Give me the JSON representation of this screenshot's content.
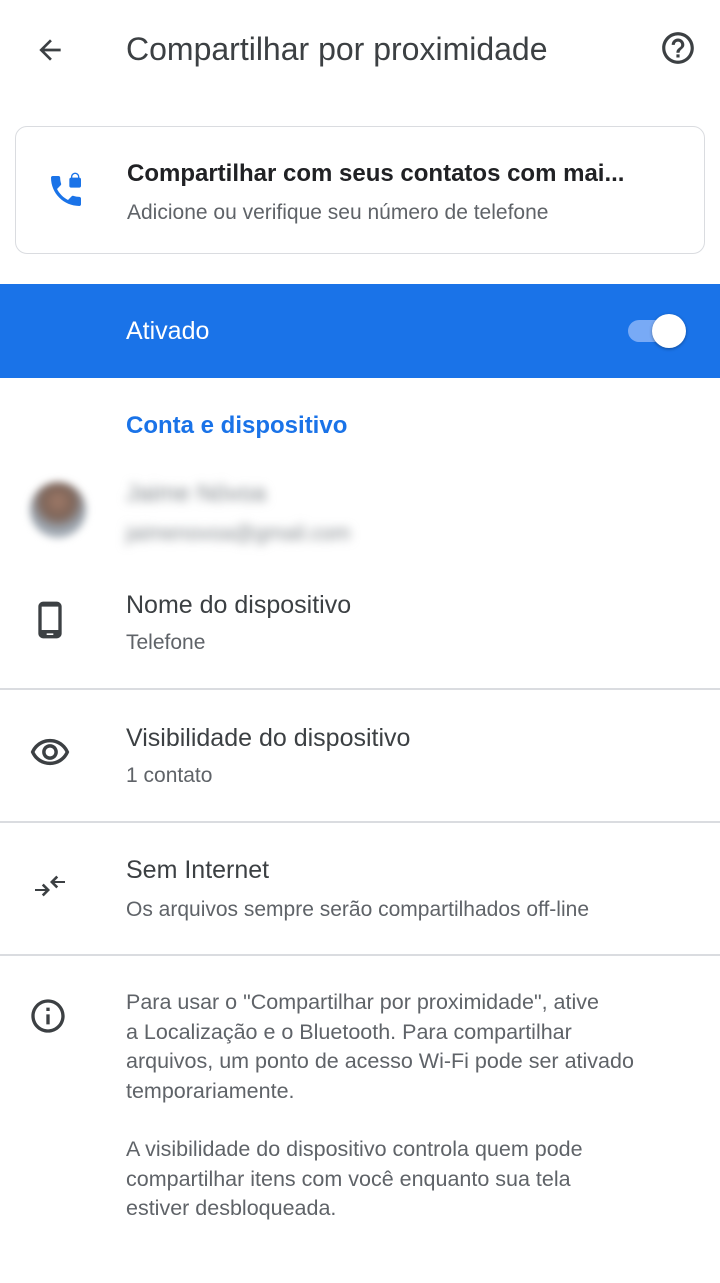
{
  "appbar": {
    "title": "Compartilhar por proximidade",
    "back_icon": "arrow-back-icon",
    "help_icon": "help-circle-icon"
  },
  "contacts_card": {
    "icon": "phone-lock-icon",
    "title": "Compartilhar com seus contatos com mai...",
    "subtitle": "Adicione ou verifique seu número de telefone"
  },
  "main_toggle": {
    "label": "Ativado",
    "state": "on"
  },
  "account_section": {
    "header": "Conta e dispositivo",
    "name": "Jaime Nóvoa",
    "email": "jaimenovoa@gmail.com"
  },
  "settings": [
    {
      "icon": "smartphone-icon",
      "title": "Nome do dispositivo",
      "subtitle": "Telefone"
    },
    {
      "icon": "eye-icon",
      "title": "Visibilidade do dispositivo",
      "subtitle": "1 contato"
    },
    {
      "icon": "offline-arrows-icon",
      "title": "Sem Internet",
      "subtitle": "Os arquivos sempre serão compartilhados off-line"
    }
  ],
  "info": {
    "icon": "info-icon",
    "paragraph1_lines": [
      "Para usar o \"Compartilhar por proximidade\", ative",
      "a Localização e o Bluetooth. Para compartilhar",
      "arquivos, um ponto de acesso Wi-Fi pode ser ativado",
      "temporariamente."
    ],
    "paragraph2_lines": [
      "A visibilidade do dispositivo controla quem pode",
      "compartilhar itens com você enquanto sua tela",
      "estiver desbloqueada."
    ]
  },
  "colors": {
    "accent": "#1a73e8",
    "text_primary": "#3c4043",
    "text_secondary": "#5f6368",
    "divider": "#dadce0"
  }
}
